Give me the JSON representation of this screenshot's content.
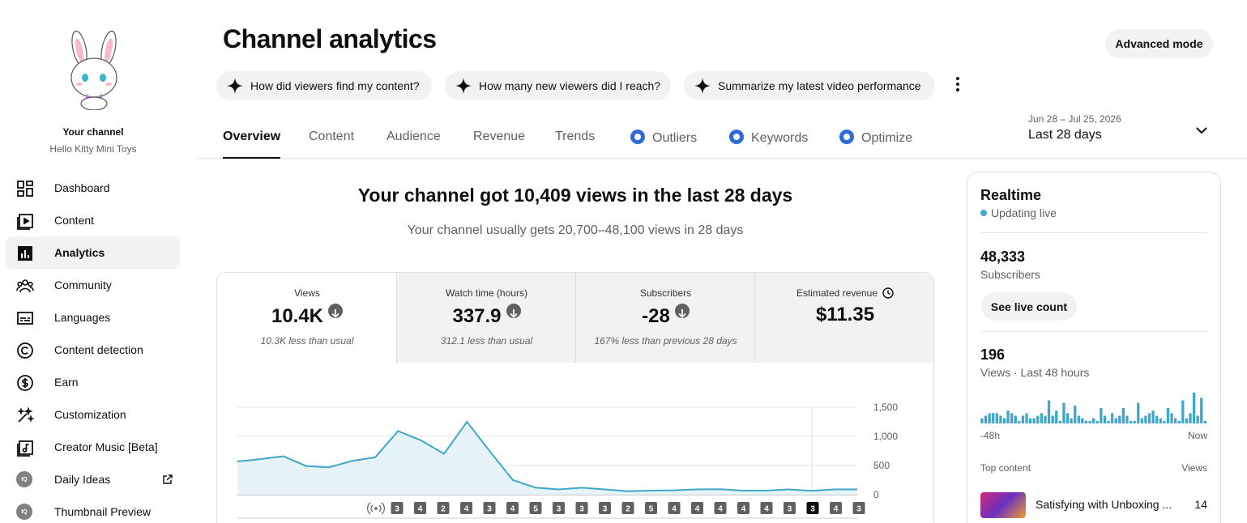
{
  "sidebar": {
    "channel_title": "Your channel",
    "channel_name": "Hello Kitty Mini Toys",
    "items": [
      {
        "label": "Dashboard",
        "icon": "dashboard-icon"
      },
      {
        "label": "Content",
        "icon": "content-icon"
      },
      {
        "label": "Analytics",
        "icon": "analytics-icon",
        "active": true
      },
      {
        "label": "Community",
        "icon": "community-icon"
      },
      {
        "label": "Languages",
        "icon": "subtitles-icon"
      },
      {
        "label": "Content detection",
        "icon": "copyright-icon"
      },
      {
        "label": "Earn",
        "icon": "dollar-icon"
      },
      {
        "label": "Customization",
        "icon": "magic-wand-icon"
      },
      {
        "label": "Creator Music [Beta]",
        "icon": "music-icon"
      },
      {
        "label": "Daily Ideas",
        "icon": "iq-icon",
        "external": true
      },
      {
        "label": "Thumbnail Preview",
        "icon": "iq-icon"
      }
    ]
  },
  "header": {
    "title": "Channel analytics",
    "advanced_mode": "Advanced mode",
    "chips": [
      "How did viewers find my content?",
      "How many new viewers did I reach?",
      "Summarize my latest video performance"
    ]
  },
  "tabs": [
    "Overview",
    "Content",
    "Audience",
    "Revenue",
    "Trends",
    "Outliers",
    "Keywords",
    "Optimize"
  ],
  "date_range": {
    "dates": "Jun 28 – Jul 25, 2026",
    "label": "Last 28 days"
  },
  "summary": {
    "headline": "Your channel got 10,409 views in the last 28 days",
    "subheadline": "Your channel usually gets 20,700–48,100 views in 28 days"
  },
  "metrics": [
    {
      "label": "Views",
      "value": "10.4K",
      "note": "10.3K less than usual",
      "trend": "down"
    },
    {
      "label": "Watch time (hours)",
      "value": "337.9",
      "note": "312.1 less than usual",
      "trend": "down"
    },
    {
      "label": "Subscribers",
      "value": "-28",
      "note": "167% less than previous 28 days",
      "trend": "down"
    },
    {
      "label": "Estimated revenue",
      "value": "$11.35",
      "note": "",
      "trend": "none"
    }
  ],
  "chart_data": {
    "type": "area",
    "x": [
      1,
      2,
      3,
      4,
      5,
      6,
      7,
      8,
      9,
      10,
      11,
      12,
      13,
      14,
      15,
      16,
      17,
      18,
      19,
      20,
      21,
      22,
      23,
      24,
      25,
      26,
      27,
      28
    ],
    "values": [
      570,
      610,
      660,
      490,
      470,
      580,
      640,
      1090,
      930,
      700,
      1250,
      740,
      250,
      120,
      90,
      120,
      90,
      60,
      70,
      75,
      90,
      95,
      70,
      70,
      90,
      65,
      90,
      90
    ],
    "ylim": [
      0,
      1500
    ],
    "y_ticks": [
      "1,500",
      "1,000",
      "500",
      "0"
    ],
    "y_tick_values": [
      1500,
      1000,
      500,
      0
    ],
    "color": "#3ea6c8",
    "upload_markers": [
      "3",
      "4",
      "2",
      "4",
      "3",
      "4",
      "5",
      "3",
      "3",
      "3",
      "2",
      "5",
      "4",
      "4",
      "4",
      "4",
      "4",
      "3",
      "3",
      "4",
      "3"
    ],
    "highlighted_marker_index": 18
  },
  "realtime": {
    "title": "Realtime",
    "status": "Updating live",
    "subscribers": "48,333",
    "subscribers_label": "Subscribers",
    "live_count_button": "See live count",
    "views": "196",
    "views_label": "Views · Last 48 hours",
    "axis_start": "-48h",
    "axis_end": "Now",
    "bars": [
      2,
      3,
      4,
      4,
      4,
      3,
      2,
      5,
      4,
      3,
      1,
      3,
      4,
      2,
      2,
      3,
      4,
      3,
      9,
      3,
      5,
      1,
      8,
      4,
      2,
      7,
      3,
      2,
      1,
      1,
      2,
      1,
      6,
      3,
      1,
      4,
      2,
      3,
      6,
      3,
      1,
      1,
      8,
      2,
      3,
      4,
      5,
      3,
      2,
      1,
      6,
      4,
      2,
      1,
      9,
      2,
      4,
      12,
      3,
      10,
      1
    ],
    "bars_max": 12,
    "top_content_label": "Top content",
    "top_content_views_label": "Views",
    "top_content": [
      {
        "title": "Satisfying with Unboxing ...",
        "views": "14"
      }
    ]
  }
}
